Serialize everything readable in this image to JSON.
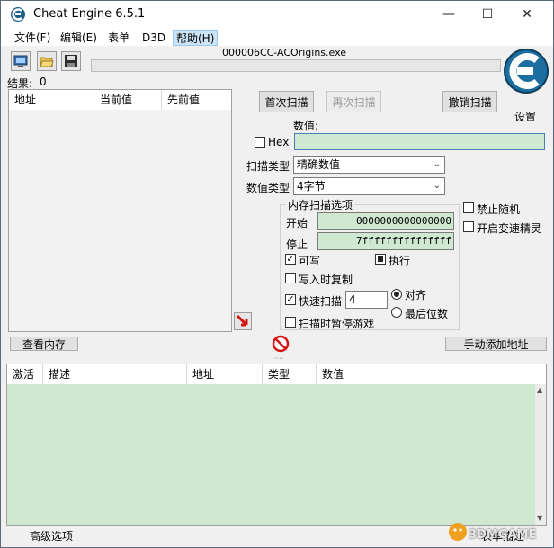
{
  "window": {
    "title": "Cheat Engine 6.5.1",
    "controls": {
      "minimize": "—",
      "maximize": "☐",
      "close": "✕"
    }
  },
  "menu": {
    "items": [
      {
        "label": "文件(F)"
      },
      {
        "label": "编辑(E)"
      },
      {
        "label": "表单"
      },
      {
        "label": "D3D"
      },
      {
        "label": "帮助(H)"
      }
    ]
  },
  "process": {
    "name": "000006CC-ACOrigins.exe"
  },
  "results": {
    "label": "结果:",
    "count": "0"
  },
  "result_list": {
    "columns": [
      "地址",
      "当前值",
      "先前值"
    ]
  },
  "logo": {
    "settings_label": "设置"
  },
  "scan": {
    "first_scan": "首次扫描",
    "next_scan": "再次扫描",
    "undo_scan": "撤销扫描",
    "value_label": "数值:",
    "hex_label": "Hex",
    "value": "",
    "scan_type_label": "扫描类型",
    "scan_type_value": "精确数值",
    "value_type_label": "数值类型",
    "value_type_value": "4字节"
  },
  "memory_options": {
    "title": "内存扫描选项",
    "start_label": "开始",
    "start_value": "0000000000000000",
    "stop_label": "停止",
    "stop_value": "7fffffffffffffff",
    "writable": "可写",
    "executable": "执行",
    "copy_on_write": "写入时复制",
    "fast_scan": "快速扫描",
    "fast_scan_value": "4",
    "align": "对齐",
    "last_digits": "最后位数",
    "pause_game": "扫描时暂停游戏"
  },
  "right_options": {
    "disable_random": "禁止随机",
    "speedhack": "开启变速精灵"
  },
  "bottom_bar": {
    "view_memory": "查看内存",
    "add_address": "手动添加地址"
  },
  "address_table": {
    "columns": [
      "激活",
      "描述",
      "地址",
      "类型",
      "数值"
    ]
  },
  "footer": {
    "advanced": "高级选项",
    "table_extras": "表单描述"
  },
  "watermark": {
    "text": "3DMGAME"
  }
}
